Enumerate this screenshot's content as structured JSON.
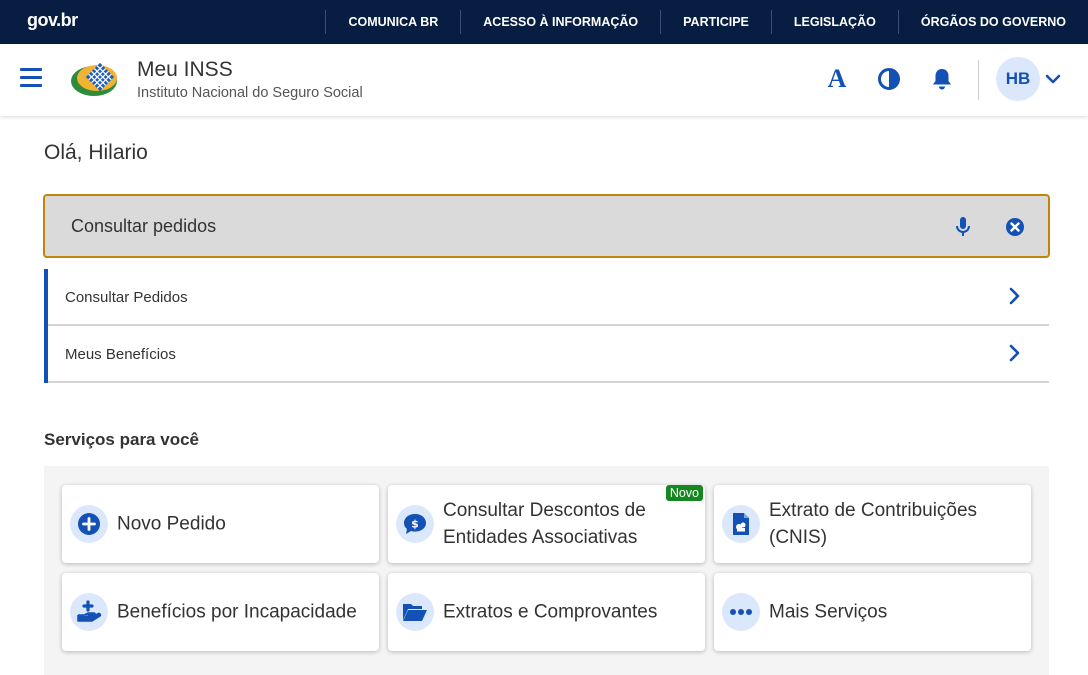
{
  "govbar": {
    "logo": "gov.br",
    "links": [
      "COMUNICA BR",
      "ACESSO À INFORMAÇÃO",
      "PARTICIPE",
      "LEGISLAÇÃO",
      "ÓRGÃOS DO GOVERNO"
    ]
  },
  "header": {
    "title": "Meu INSS",
    "subtitle": "Instituto Nacional do Seguro Social",
    "font_icon_glyph": "A",
    "avatar_initials": "HB"
  },
  "greeting": "Olá, Hilario",
  "search": {
    "value": "Consultar pedidos"
  },
  "results": [
    {
      "label": "Consultar Pedidos"
    },
    {
      "label": "Meus Benefícios"
    }
  ],
  "services": {
    "title": "Serviços para você",
    "cards": [
      {
        "label": "Novo Pedido",
        "icon": "plus-circle-icon"
      },
      {
        "label": "Consultar Descontos de Entidades Associativas",
        "icon": "money-chat-icon",
        "badge": "Novo"
      },
      {
        "label": "Extrato de Contribuições (CNIS)",
        "icon": "document-icon"
      },
      {
        "label": "Benefícios por Incapacidade",
        "icon": "hand-plus-icon"
      },
      {
        "label": "Extratos e Comprovantes",
        "icon": "folder-open-icon"
      },
      {
        "label": "Mais Serviços",
        "icon": "more-dots-icon"
      }
    ]
  },
  "colors": {
    "govbar_bg": "#071d41",
    "primary_blue": "#1351b4",
    "search_border": "#c2850c",
    "badge_green": "#168821"
  }
}
